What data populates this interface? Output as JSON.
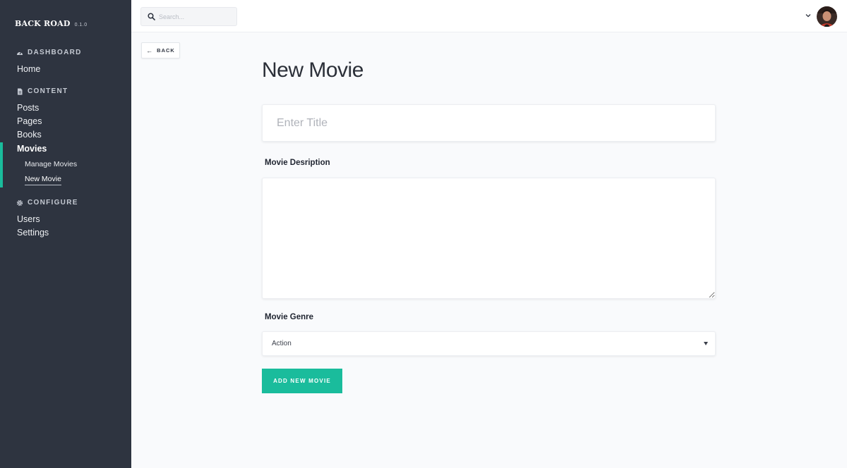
{
  "brand": {
    "name": "BACK ROAD",
    "version": "0.1.0"
  },
  "sidebar": {
    "sections": [
      {
        "title": "DASHBOARD",
        "icon": "gauge-icon",
        "items": [
          "Home"
        ]
      },
      {
        "title": "CONTENT",
        "icon": "document-icon",
        "items": [
          "Posts",
          "Pages",
          "Books",
          "Movies"
        ]
      },
      {
        "title": "CONFIGURE",
        "icon": "gear-icon",
        "items": [
          "Users",
          "Settings"
        ]
      }
    ],
    "active_item": "Movies",
    "sub_items": [
      "Manage Movies",
      "New Movie"
    ],
    "current_sub_item": "New Movie"
  },
  "header": {
    "search_placeholder": "Search..."
  },
  "main": {
    "back_label": "BACK",
    "page_title": "New Movie",
    "title_placeholder": "Enter Title",
    "description_label": "Movie Desription",
    "genre_label": "Movie Genre",
    "genre_value": "Action",
    "submit_label": "ADD NEW MOVIE"
  },
  "colors": {
    "sidebar_bg": "#2e3440",
    "accent": "#1abc9c",
    "page_bg": "#f9fafc"
  }
}
